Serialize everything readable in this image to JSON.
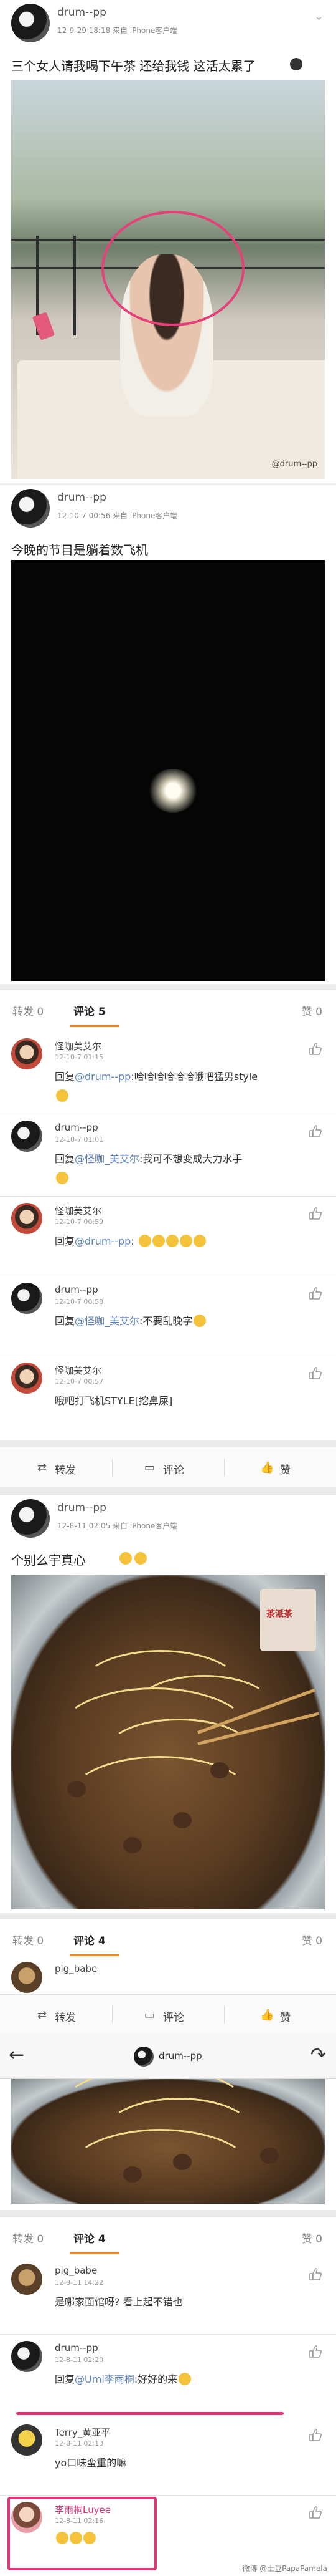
{
  "post1": {
    "username": "drum--pp",
    "meta": "12-9-29 18:18  来自 iPhone客户端",
    "text": "三个女人请我喝下午茶 还给我钱 这活太累了",
    "watermark": "@drum--pp"
  },
  "post2": {
    "username": "drum--pp",
    "meta": "12-10-7 00:56  来自 iPhone客户端",
    "text": "今晚的节目是躺着数飞机"
  },
  "tabs1": {
    "repost": "转发 0",
    "comment": "评论 5",
    "likes": "赞 0"
  },
  "comments1": [
    {
      "name": "怪咖美艾尔",
      "time": "12-10-7 01:15",
      "prefix": "回复",
      "mention": "@drum--pp",
      "text": ":哈哈哈哈哈哈哦吧猛男style",
      "avatar": "red"
    },
    {
      "name": "drum--pp",
      "time": "12-10-7 01:01",
      "prefix": "回复",
      "mention": "@怪咖_美艾尔",
      "text": ":我可不想变成大力水手",
      "avatar": "dark"
    },
    {
      "name": "怪咖美艾尔",
      "time": "12-10-7 00:59",
      "prefix": "回复",
      "mention": "@drum--pp",
      "text": ":",
      "avatar": "red"
    },
    {
      "name": "drum--pp",
      "time": "12-10-7 00:58",
      "prefix": "回复",
      "mention": "@怪咖_美艾尔",
      "text": ":不要乱晚字",
      "avatar": "dark"
    },
    {
      "name": "怪咖美艾尔",
      "time": "12-10-7 00:57",
      "prefix": "",
      "mention": "",
      "text": "哦吧打飞机STYLE[挖鼻屎]",
      "avatar": "red"
    }
  ],
  "actions1": {
    "repost": "转发",
    "comment": "评论",
    "like": "赞"
  },
  "post3": {
    "username": "drum--pp",
    "meta": "12-8-11 02:05  来自 iPhone客户端",
    "text": "个别么宇真心",
    "can_label": "茶派茶"
  },
  "tabs2": {
    "repost": "转发 0",
    "comment": "评论 4",
    "likes": "赞 0"
  },
  "partial_comment": {
    "name": "pig_babe"
  },
  "actions2": {
    "repost": "转发",
    "comment": "评论",
    "like": "赞"
  },
  "nav": {
    "name": "drum--pp"
  },
  "tabs3": {
    "repost": "转发 0",
    "comment": "评论 4",
    "likes": "赞 0"
  },
  "comments2": [
    {
      "name": "pig_babe",
      "time": "12-8-11 14:22",
      "prefix": "",
      "mention": "",
      "text": "是哪家面馆呀? 看上起不错也",
      "avatar": "brown"
    },
    {
      "name": "drum--pp",
      "time": "12-8-11 02:20",
      "prefix": "回复",
      "mention": "@Uml李雨桐",
      "text": ":好好的来",
      "avatar": "dark"
    },
    {
      "name": "Terry_黄亚平",
      "time": "12-8-11 02:13",
      "prefix": "",
      "mention": "",
      "text": "yo口味蛮重的嘛",
      "avatar": "yellow"
    },
    {
      "name": "李雨桐Luyee",
      "time": "12-8-11 02:16",
      "prefix": "",
      "mention": "",
      "text": "",
      "avatar": "pink"
    }
  ],
  "bottom_watermark": "微博 @土豆PapaPamela"
}
